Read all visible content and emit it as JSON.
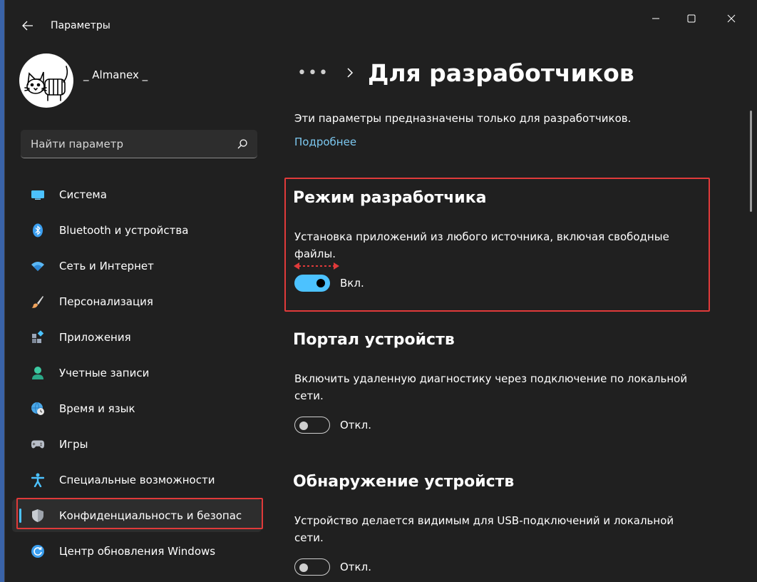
{
  "window": {
    "title": "Параметры",
    "back_icon": "back-arrow-icon",
    "controls": [
      "minimize-icon",
      "maximize-icon",
      "close-icon"
    ]
  },
  "profile": {
    "name": "_ Almanex _",
    "avatar": "cat-drawing-avatar"
  },
  "search": {
    "placeholder": "Найти параметр",
    "icon": "search-icon"
  },
  "sidebar": {
    "items": [
      {
        "label": "Система",
        "icon": "display-icon",
        "color": "#4cc2ff"
      },
      {
        "label": "Bluetooth и устройства",
        "icon": "bluetooth-icon",
        "color": "#3b9ff0"
      },
      {
        "label": "Сеть и Интернет",
        "icon": "wifi-icon",
        "color": "#5bb8f5"
      },
      {
        "label": "Персонализация",
        "icon": "brush-icon",
        "color": "#f0a35c"
      },
      {
        "label": "Приложения",
        "icon": "apps-icon",
        "color": "#9aa6b8"
      },
      {
        "label": "Учетные записи",
        "icon": "person-icon",
        "color": "#3dc9a1"
      },
      {
        "label": "Время и язык",
        "icon": "globe-clock-icon",
        "color": "#4aa8e8"
      },
      {
        "label": "Игры",
        "icon": "gamepad-icon",
        "color": "#b8bec8"
      },
      {
        "label": "Специальные возможности",
        "icon": "accessibility-icon",
        "color": "#4cc2ff"
      },
      {
        "label": "Конфиденциальность и безопас",
        "icon": "shield-icon",
        "color": "#9ea4ac",
        "active": true
      },
      {
        "label": "Центр обновления Windows",
        "icon": "update-icon",
        "color": "#3b9ff0"
      }
    ]
  },
  "main": {
    "breadcrumb_more": "•••",
    "title": "Для разработчиков",
    "intro": "Эти параметры предназначены только для разработчиков.",
    "more_link": "Подробнее",
    "sections": [
      {
        "title": "Режим разработчика",
        "description": "Установка приложений из любого источника, включая свободные файлы.",
        "toggle_state": "Вкл.",
        "on": true
      },
      {
        "title": "Портал устройств",
        "description": "Включить удаленную диагностику через подключение по локальной сети.",
        "toggle_state": "Откл.",
        "on": false
      },
      {
        "title": "Обнаружение устройств",
        "description": "Устройство делается видимым для USB-подключений и локальной сети.",
        "toggle_state": "Откл.",
        "on": false
      }
    ]
  },
  "colors": {
    "accent": "#4cc2ff",
    "highlight": "#e03a3a",
    "background": "#202020"
  }
}
